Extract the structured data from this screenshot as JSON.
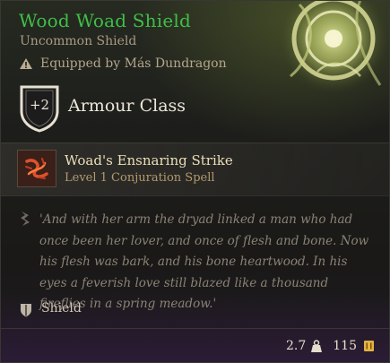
{
  "item": {
    "name": "Wood Woad Shield",
    "rarity_type": "Uncommon Shield",
    "equipped_by": "Equipped by Más Dundragon",
    "rarity_color": "#3fbf47"
  },
  "armour": {
    "bonus": "+2",
    "label": "Armour Class"
  },
  "spell": {
    "name": "Woad's Ensnaring Strike",
    "detail": "Level 1 Conjuration Spell"
  },
  "flavor_text": "'And with her arm the dryad linked a man who had once been her lover, and once of flesh and bone. Now his flesh was bark, and his bone heartwood. In his eyes a feverish love still blazed like a thousand fireflies in a spring meadow.'",
  "category": "Shield",
  "footer": {
    "weight": "2.7",
    "value": "115"
  },
  "icons": {
    "warning": "warning-triangle-icon",
    "armour": "shield-badge-icon",
    "spell": "ensnaring-strike-icon",
    "flavor": "quill-icon",
    "category": "shield-icon",
    "weight": "weight-icon",
    "value": "gold-coin-icon"
  }
}
